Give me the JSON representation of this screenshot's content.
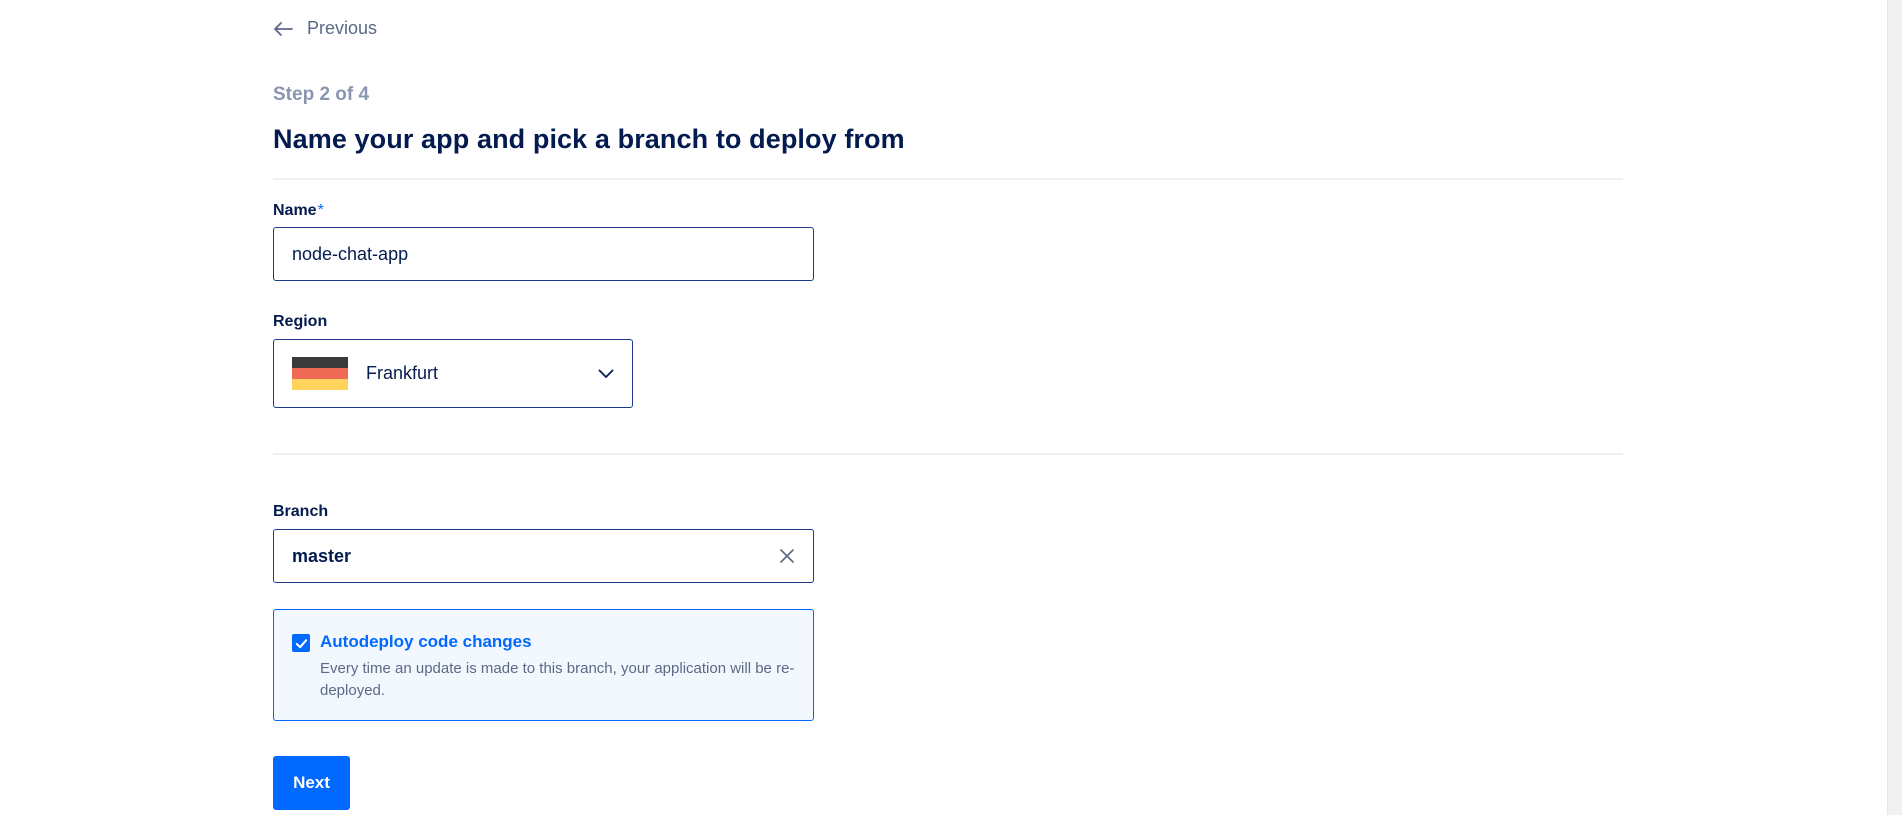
{
  "nav": {
    "previous_label": "Previous"
  },
  "header": {
    "step": "Step 2 of 4",
    "title": "Name your app and pick a branch to deploy from"
  },
  "form": {
    "name_label": "Name",
    "required_mark": "*",
    "name_value": "node-chat-app",
    "region_label": "Region",
    "region_value": "Frankfurt",
    "region_flag_colors": [
      "#3b3b3b",
      "#ee6a55",
      "#ffd35c"
    ],
    "branch_label": "Branch",
    "branch_value": "master",
    "autodeploy": {
      "checked": true,
      "title": "Autodeploy code changes",
      "description": "Every time an update is made to this branch, your application will be re-deployed."
    },
    "next_label": "Next"
  },
  "colors": {
    "primary": "#0069ff",
    "text_dark": "#031b4e",
    "text_muted": "#5b6987"
  }
}
